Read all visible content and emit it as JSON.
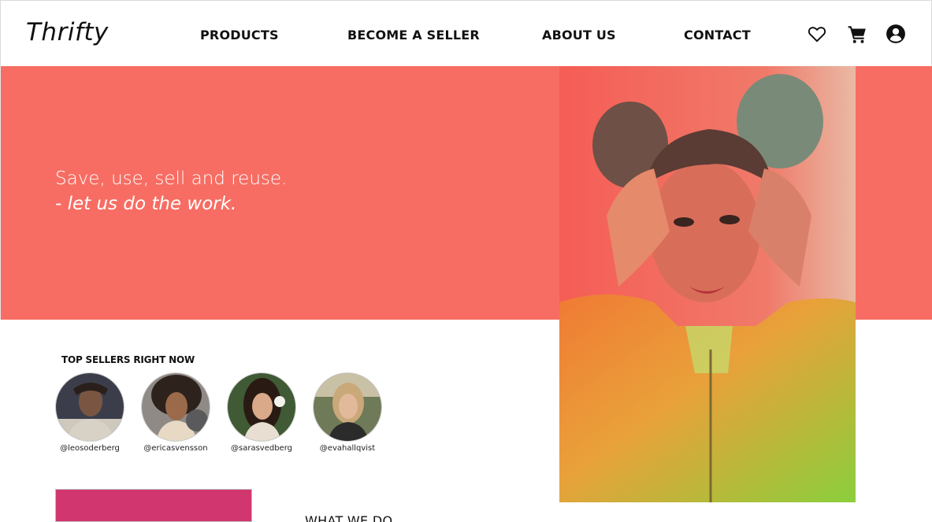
{
  "brand": {
    "logo": "Thrifty"
  },
  "nav": {
    "items": [
      "PRODUCTS",
      "BECOME A SELLER",
      "ABOUT US",
      "CONTACT"
    ],
    "icons": [
      "heart-icon",
      "cart-icon",
      "account-icon"
    ]
  },
  "hero": {
    "line1": "Save, use, sell and reuse.",
    "line2": "- let us do the work.",
    "band_color": "#f76d63"
  },
  "sellers": {
    "title": "TOP SELLERS RIGHT NOW",
    "items": [
      {
        "handle": "@leosoderberg"
      },
      {
        "handle": "@ericasvensson"
      },
      {
        "handle": "@sarasvedberg"
      },
      {
        "handle": "@evahallqvist"
      }
    ]
  },
  "section": {
    "heading": "WHAT WE DO"
  },
  "colors": {
    "accent": "#f76d63",
    "pink": "#d2366e"
  }
}
